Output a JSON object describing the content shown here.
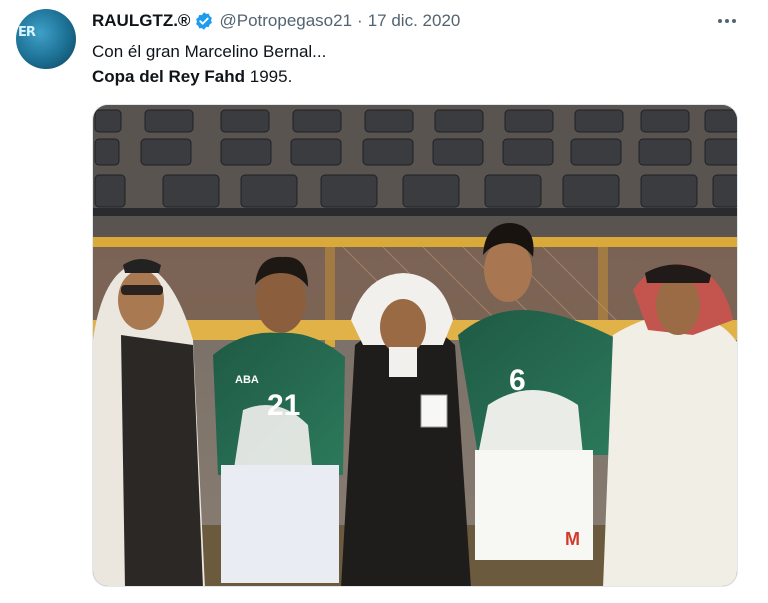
{
  "tweet": {
    "display_name": "RAULGTZ.®",
    "handle": "@Potropegaso21",
    "separator": "·",
    "date": "17 dic. 2020",
    "avatar_text": "ER",
    "text_line1": "Con él gran Marcelino Bernal...",
    "text_line2_bold": "Copa del Rey Fahd",
    "text_line2_rest": " 1995.",
    "icons": {
      "verified": "verified-badge-icon",
      "more": "more-options-icon"
    },
    "colors": {
      "verified": "#1d9bf0",
      "muted": "#536471"
    }
  },
  "photo": {
    "jersey_numbers": [
      "21",
      "6"
    ],
    "shirt_brand": "ABA",
    "shorts_logo": "M"
  }
}
